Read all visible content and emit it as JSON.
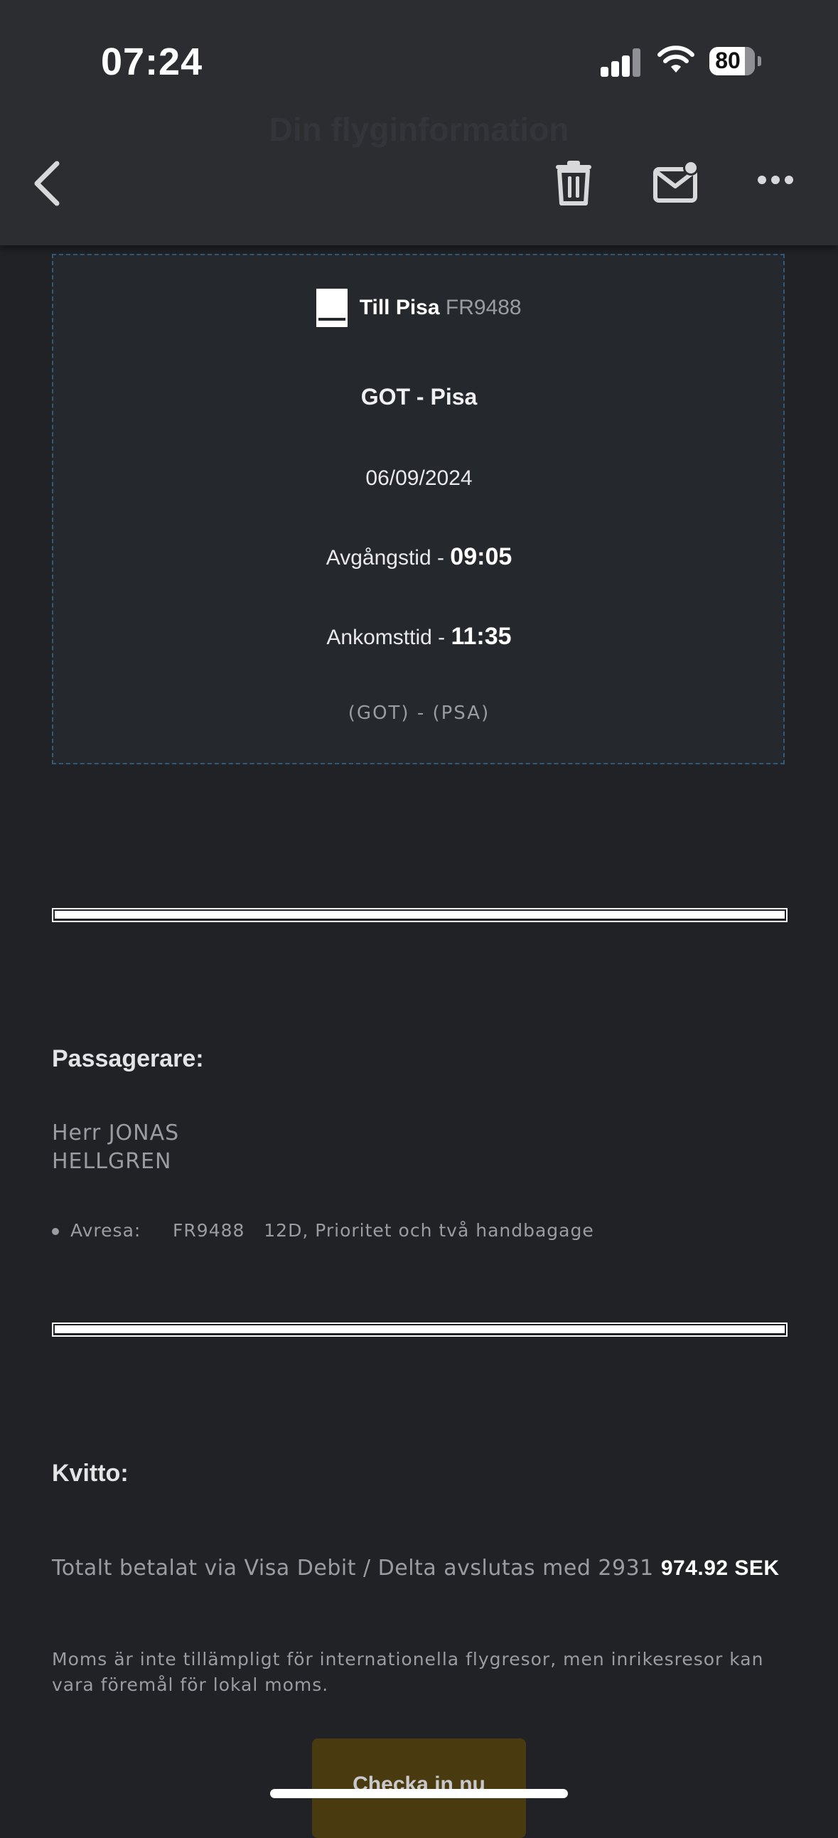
{
  "status_bar": {
    "time": "07:24",
    "battery": "80"
  },
  "header": {
    "title": "Din flyginformation"
  },
  "flight": {
    "to_label": "Till Pisa",
    "flight_number": "FR9488",
    "route": "GOT - Pisa",
    "date": "06/09/2024",
    "departure_label": "Avgångstid - ",
    "departure_time": "09:05",
    "arrival_label": "Ankomsttid - ",
    "arrival_time": "11:35",
    "codes": "(GOT) - (PSA)"
  },
  "passengers": {
    "heading": "Passagerare:",
    "name_line1": "Herr JONAS",
    "name_line2": "HELLGREN",
    "item": "Avresa:     FR9488   12D, Prioritet och två handbagage"
  },
  "receipt": {
    "heading": "Kvitto:",
    "text": "Totalt betalat via Visa Debit / Delta avslutas med 2931 ",
    "amount": "974.92 SEK",
    "note": "Moms är inte tillämpligt för internationella flygresor, men inrikesresor kan vara föremål för lokal moms."
  },
  "cta": {
    "label": "Checka in nu"
  },
  "icons": [
    "back-chevron-icon",
    "trash-icon",
    "mail-unread-icon",
    "more-icon",
    "signal-icon",
    "wifi-icon",
    "battery-icon",
    "plane-icon"
  ],
  "colors": {
    "background": "#212226",
    "topbar": "#2c2d31",
    "card": "#25282c",
    "cta": "#4a3a10"
  }
}
